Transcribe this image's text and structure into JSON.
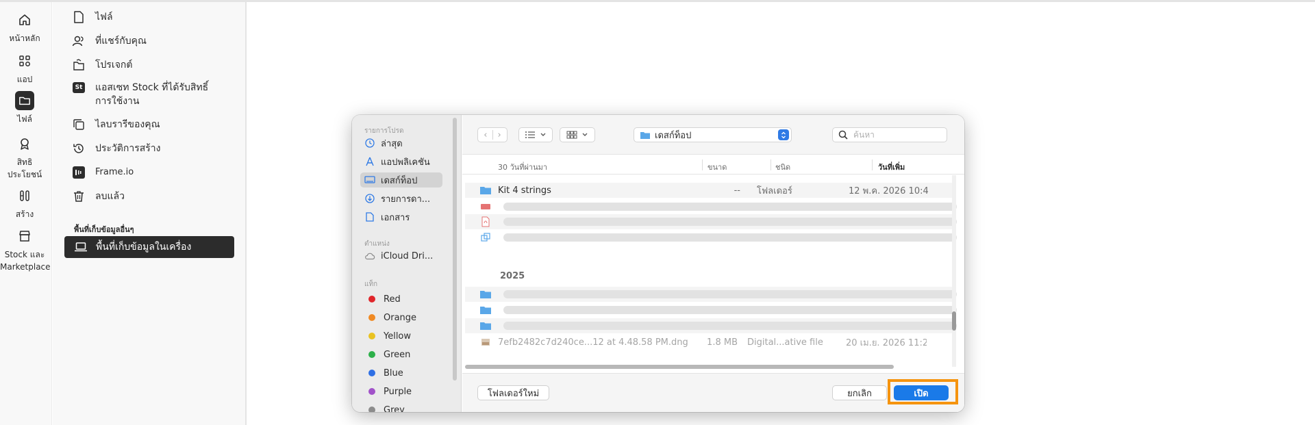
{
  "rail": {
    "items": [
      {
        "label": "หน้าหลัก",
        "icon": "home-icon"
      },
      {
        "label": "แอป",
        "icon": "apps-icon"
      },
      {
        "label": "ไฟล์",
        "icon": "folder-icon"
      },
      {
        "label": "สิทธิ\nประโยชน์",
        "icon": "award-icon"
      },
      {
        "label": "สร้าง",
        "icon": "create-icon"
      },
      {
        "label": "Stock และ\nMarketplace",
        "icon": "store-icon"
      }
    ]
  },
  "panel": {
    "items": [
      {
        "label": "ไฟล์",
        "icon": "file-icon"
      },
      {
        "label": "ที่แชร์กับคุณ",
        "icon": "shared-users-icon"
      },
      {
        "label": "โปรเจกต์",
        "icon": "project-icon"
      },
      {
        "label": "แอสเซท Stock ที่ได้รับสิทธิ์\nการใช้งาน",
        "icon": "stock-icon",
        "badge": "St"
      },
      {
        "label": "ไลบรารีของคุณ",
        "icon": "library-icon"
      },
      {
        "label": "ประวัติการสร้าง",
        "icon": "history-icon"
      },
      {
        "label": "Frame.io",
        "icon": "frameio-icon"
      },
      {
        "label": "ลบแล้ว",
        "icon": "trash-icon"
      }
    ],
    "section_title": "พื้นที่เก็บข้อมูลอื่นๆ",
    "selected": {
      "label": "พื้นที่เก็บข้อมูลในเครื่อง",
      "icon": "laptop-icon"
    }
  },
  "dialog": {
    "sidebar": {
      "favorites_title": "รายการโปรด",
      "favorites": [
        {
          "label": "ล่าสุด",
          "icon": "clock-icon"
        },
        {
          "label": "แอปพลิเคชัน",
          "icon": "applications-icon"
        },
        {
          "label": "เดสก์ท็อป",
          "icon": "desktop-icon"
        },
        {
          "label": "รายการดา...",
          "icon": "download-icon"
        },
        {
          "label": "เอกสาร",
          "icon": "document-icon"
        }
      ],
      "locations_title": "ตำแหน่ง",
      "locations": [
        {
          "label": "iCloud Dri...",
          "icon": "cloud-icon"
        }
      ],
      "tags_title": "แท็ก",
      "tags": [
        {
          "label": "Red",
          "color": "#e0262b"
        },
        {
          "label": "Orange",
          "color": "#f08a24"
        },
        {
          "label": "Yellow",
          "color": "#e9c221"
        },
        {
          "label": "Green",
          "color": "#2db04a"
        },
        {
          "label": "Blue",
          "color": "#2f6fe4"
        },
        {
          "label": "Purple",
          "color": "#a152c9"
        },
        {
          "label": "Grey",
          "color": "#8c8c8c"
        }
      ]
    },
    "toolbar": {
      "location": "เดสก์ท็อป",
      "search_placeholder": "ค้นหา"
    },
    "columns": {
      "name": "30 วันที่ผ่านมา",
      "size": "ขนาด",
      "kind": "ชนิด",
      "date": "วันที่เพิ่ม"
    },
    "rows": [
      {
        "name": "Kit 4 strings",
        "size": "--",
        "kind": "โฟลเดอร์",
        "date": "12 พ.ค. 2026 10:4"
      }
    ],
    "group_2025": "2025",
    "last_row": {
      "name": "7efb2482c7d240ce...12 at 4.48.58 PM.dng",
      "size": "1.8 MB",
      "kind": "Digital...ative file",
      "date": "20 เม.ย. 2026 11:2"
    },
    "footer": {
      "new_folder": "โฟลเดอร์ใหม่",
      "cancel": "ยกเลิก",
      "open": "เปิด"
    }
  }
}
